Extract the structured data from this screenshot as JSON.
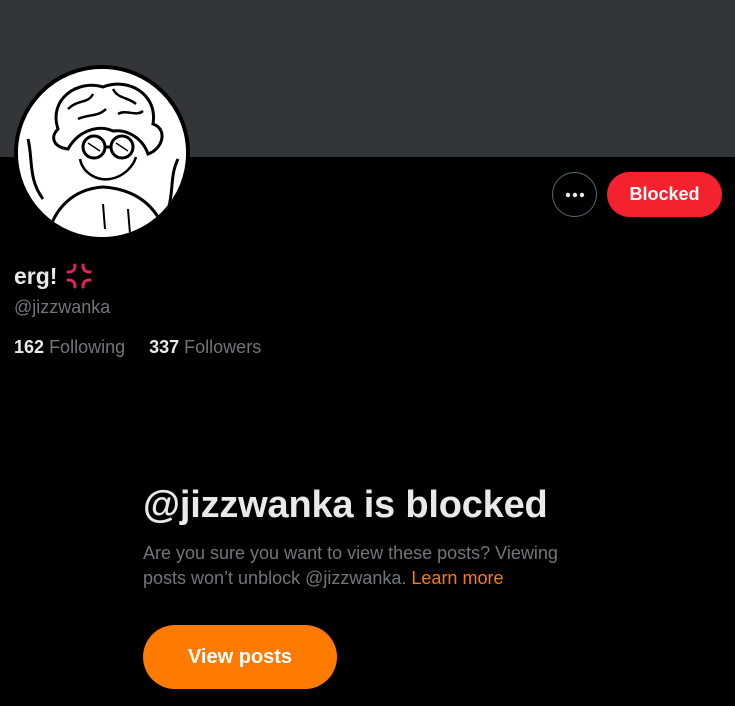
{
  "profile": {
    "display_name": "erg!",
    "handle": "@jizzwanka",
    "emoji_icon": "anger-symbol-icon",
    "following_count": "162",
    "following_label": "Following",
    "followers_count": "337",
    "followers_label": "Followers"
  },
  "actions": {
    "more_icon": "more-horizontal-icon",
    "blocked_label": "Blocked"
  },
  "blocked_notice": {
    "title": "@jizzwanka is blocked",
    "description": "Are you sure you want to view these posts? Viewing posts won’t unblock @jizzwanka.",
    "learn_more": "Learn more",
    "view_posts_label": "View posts"
  },
  "colors": {
    "background": "#000000",
    "banner": "#333639",
    "blocked_button": "#f4212e",
    "accent": "#ff7a00",
    "secondary_text": "#71767b",
    "primary_text": "#e7e9ea"
  }
}
